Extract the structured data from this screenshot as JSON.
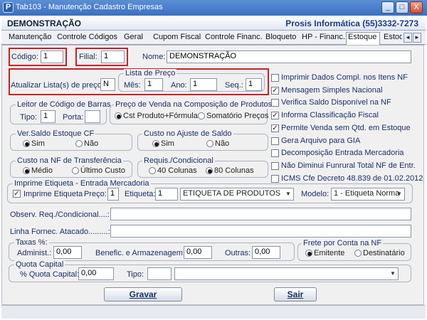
{
  "window": {
    "title": "Tab103 - Manutenção Cadastro Empresas",
    "minimize": "_",
    "maximize": "□",
    "close": "X"
  },
  "header": {
    "company": "DEMONSTRAÇÃO",
    "vendor": "Prosis Informática (55)3332-7273"
  },
  "tabs": [
    "Manutenção",
    "Controle Códigos",
    "Geral",
    "Cupom Fiscal",
    "Controle Financ.",
    "Bloqueto",
    "HP - Financ.",
    "Estoque",
    "Estoq"
  ],
  "active_tab": "Estoque",
  "fields": {
    "codigo_label": "Código:",
    "codigo_value": "1",
    "filial_label": "Filial:",
    "filial_value": "1",
    "nome_label": "Nome:",
    "nome_value": "DEMONSTRAÇÃO"
  },
  "lista_preco": {
    "title": "Lista de Preço",
    "atualizar_label": "Atualizar Lista(s) de preço:",
    "atualizar_value": "N",
    "mes_label": "Mês:",
    "mes_value": "1",
    "ano_label": "Ano:",
    "ano_value": "1",
    "seq_label": "Seq.:",
    "seq_value": "1"
  },
  "leitor": {
    "title": "Leitor de Código de Barras",
    "tipo_label": "Tipo:",
    "tipo_value": "1",
    "porta_label": "Porta:",
    "porta_value": ""
  },
  "preco_venda": {
    "title": "Preço de Venda na Composição de Produtos",
    "opt1": "Cst Produto+Fórmula",
    "opt2": "Somatório Preços"
  },
  "ver_saldo": {
    "title": "Ver.Saldo Estoque CF",
    "opt1": "Sim",
    "opt2": "Não"
  },
  "custo_ajuste": {
    "title": "Custo no Ajuste de Saldo",
    "opt1": "Sim",
    "opt2": "Não"
  },
  "custo_nf": {
    "title": "Custo na NF de Transferência",
    "opt1": "Médio",
    "opt2": "Último Custo"
  },
  "requis": {
    "title": "Requis./Condicional",
    "opt1": "40 Colunas",
    "opt2": "80 Colunas"
  },
  "checks": [
    {
      "label": "Imprimir Dados Compl. nos Itens NF",
      "checked": false
    },
    {
      "label": "Mensagem Simples Nacional",
      "checked": true
    },
    {
      "label": "Verifica Saldo Disponível na NF",
      "checked": false
    },
    {
      "label": "Informa Classificação Fiscal",
      "checked": true
    },
    {
      "label": "Permite Venda sem Qtd. em Estoque",
      "checked": true
    },
    {
      "label": "Gera Arquivo para GIA",
      "checked": false
    },
    {
      "label": "Decomposição Entrada Mercadoria",
      "checked": false
    },
    {
      "label": "Não Diminui Funrural Total NF de Entr.",
      "checked": false
    },
    {
      "label": "ICMS Cfe Decreto 48.839 de 01.02.2012",
      "checked": false
    }
  ],
  "etiqueta": {
    "title": "Imprime Etiqueta - Entrada Mercadoria",
    "imprime_label": "Imprime Etiqueta",
    "preco_label": "Preço:",
    "preco_value": "1",
    "etiqueta_label": "Etiqueta:",
    "etiqueta_value": "1",
    "etiqueta_select": "ETIQUETA DE PRODUTOS",
    "modelo_label": "Modelo:",
    "modelo_select": "1 - Etiqueta Norma"
  },
  "observ_label": "Observ. Req./Condicional....:",
  "linha_label": "Linha Fornec. Atacado.........:",
  "taxas": {
    "title": "Taxas %:",
    "adm_label": "Administ.:",
    "adm_value": "0,00",
    "benef_label": "Benefic. e Armazenagem:",
    "benef_value": "0,00",
    "outras_label": "Outras:",
    "outras_value": "0,00"
  },
  "frete": {
    "title": "Frete por Conta na NF",
    "opt1": "Emitente",
    "opt2": "Destinatário"
  },
  "quota": {
    "title": "Quota Capital",
    "pct_label": "% Quota Capital:",
    "pct_value": "0,00",
    "tipo_label": "Tipo:",
    "tipo_value": ""
  },
  "buttons": {
    "gravar": "Gravar",
    "sair": "Sair"
  },
  "icons": {
    "tab_prev": "◄",
    "tab_next": "►",
    "dropdown": "▼",
    "check": "✓"
  }
}
